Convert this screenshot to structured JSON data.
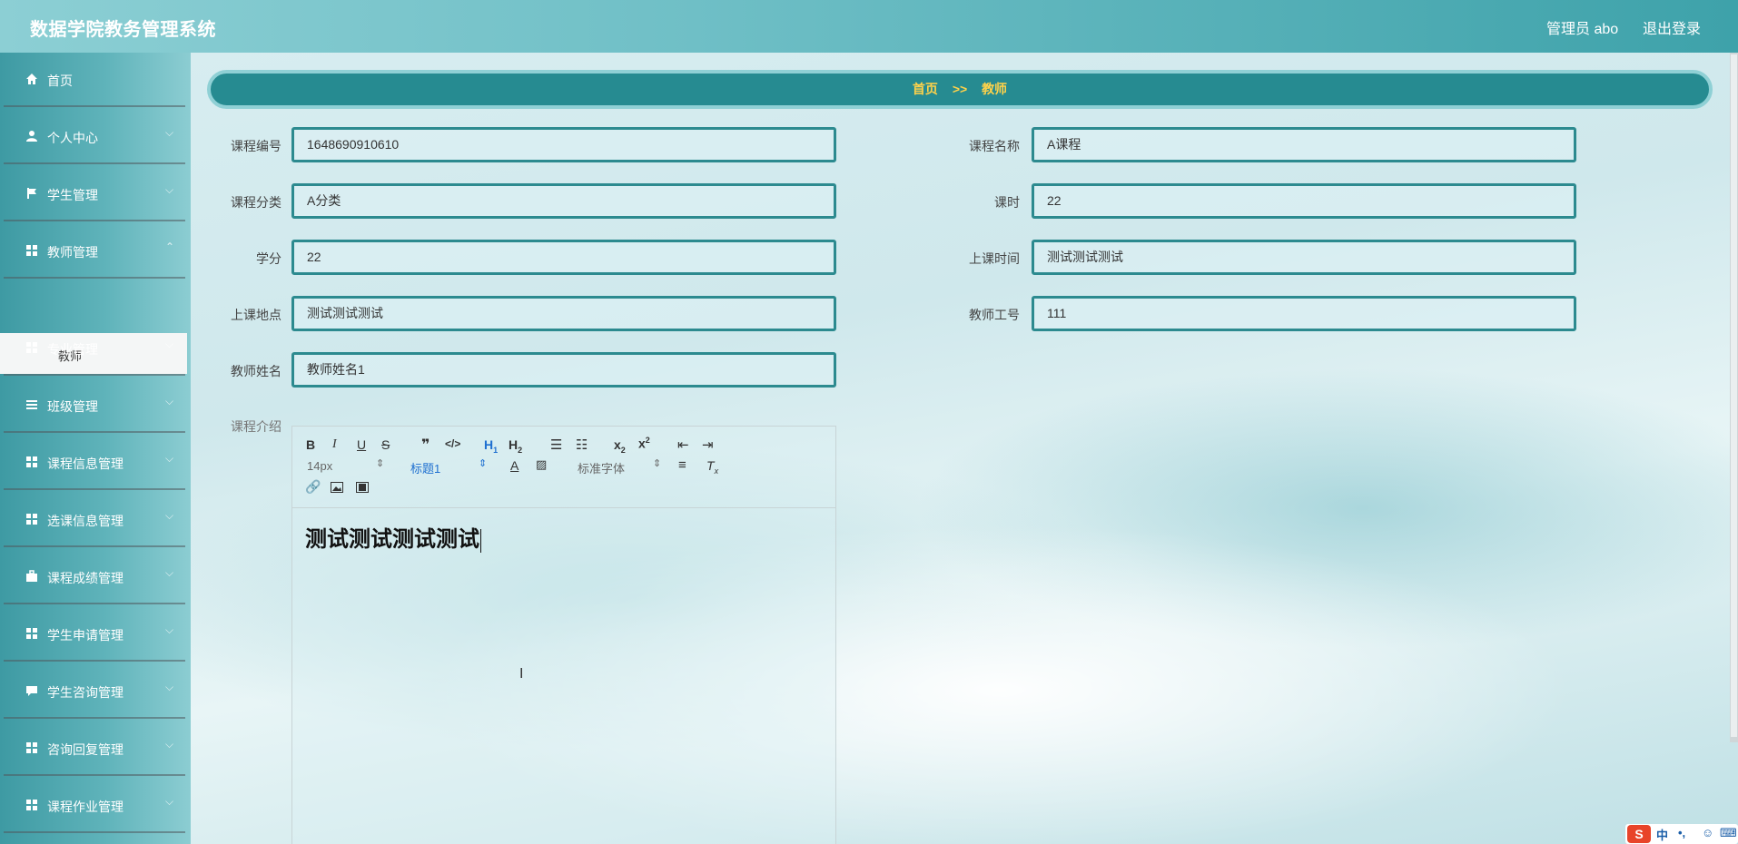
{
  "header": {
    "title": "数据学院教务管理系统",
    "admin_label": "管理员 abo",
    "logout_label": "退出登录"
  },
  "sidebar": {
    "items": [
      {
        "label": "首页",
        "icon": "home-icon",
        "has_chevron": false
      },
      {
        "label": "个人中心",
        "icon": "user-icon",
        "has_chevron": true
      },
      {
        "label": "学生管理",
        "icon": "flag-icon",
        "has_chevron": true
      },
      {
        "label": "教师管理",
        "icon": "grid-icon",
        "has_chevron": true
      },
      {
        "label": "专业管理",
        "icon": "grid-icon",
        "has_chevron": true
      },
      {
        "label": "班级管理",
        "icon": "list-icon",
        "has_chevron": true
      },
      {
        "label": "课程信息管理",
        "icon": "grid-icon",
        "has_chevron": true
      },
      {
        "label": "选课信息管理",
        "icon": "grid-icon",
        "has_chevron": true
      },
      {
        "label": "课程成绩管理",
        "icon": "briefcase-icon",
        "has_chevron": true
      },
      {
        "label": "学生申请管理",
        "icon": "grid-icon",
        "has_chevron": true
      },
      {
        "label": "学生咨询管理",
        "icon": "chat-icon",
        "has_chevron": true
      },
      {
        "label": "咨询回复管理",
        "icon": "grid-icon",
        "has_chevron": true
      },
      {
        "label": "课程作业管理",
        "icon": "grid-icon",
        "has_chevron": true
      }
    ],
    "active_sub": "教师"
  },
  "breadcrumb": {
    "home": "首页",
    "separator": ">>",
    "current": "教师"
  },
  "form": {
    "course_no_label": "课程编号",
    "course_no_value": "1648690910610",
    "course_name_label": "课程名称",
    "course_name_value": "A课程",
    "category_label": "课程分类",
    "category_value": "A分类",
    "hours_label": "课时",
    "hours_value": "22",
    "credit_label": "学分",
    "credit_value": "22",
    "time_label": "上课时间",
    "time_value": "测试测试测试",
    "location_label": "上课地点",
    "location_value": "测试测试测试",
    "teacher_no_label": "教师工号",
    "teacher_no_value": "111",
    "teacher_name_label": "教师姓名",
    "teacher_name_value": "教师姓名1",
    "intro_label": "课程介绍"
  },
  "editor": {
    "font_size": "14px",
    "heading": "标题1",
    "font_family": "标准字体",
    "content": "测试测试测试测试"
  },
  "ime": {
    "logo": "S",
    "lang": "中",
    "punct": "•,",
    "emoji": "☺",
    "keyboard": "⌨"
  }
}
